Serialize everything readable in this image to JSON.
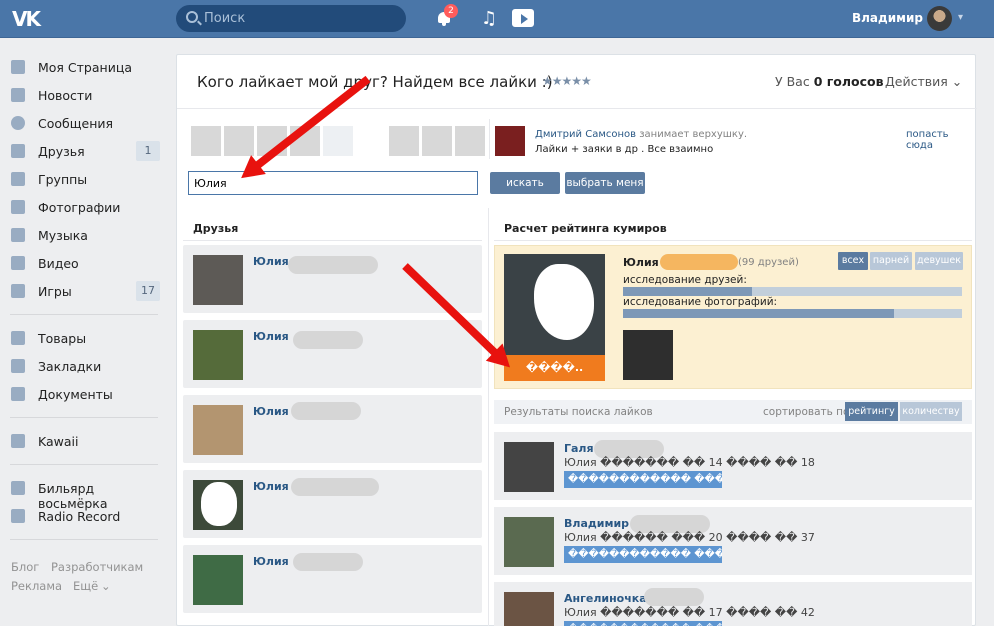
{
  "header": {
    "logo": "VK",
    "search_placeholder": "Поиск",
    "notifications_count": "2",
    "user_name": "Владимир"
  },
  "sidebar": {
    "items": [
      {
        "label": "Моя Страница",
        "icon": "house-icon"
      },
      {
        "label": "Новости",
        "icon": "news-icon"
      },
      {
        "label": "Сообщения",
        "icon": "messages-icon"
      },
      {
        "label": "Друзья",
        "icon": "friends-icon",
        "count": "1"
      },
      {
        "label": "Группы",
        "icon": "groups-icon"
      },
      {
        "label": "Фотографии",
        "icon": "camera-icon"
      },
      {
        "label": "Музыка",
        "icon": "music-icon"
      },
      {
        "label": "Видео",
        "icon": "video-icon"
      },
      {
        "label": "Игры",
        "icon": "gamepad-icon",
        "count": "17"
      },
      {
        "label": "Товары",
        "icon": "bag-icon"
      },
      {
        "label": "Закладки",
        "icon": "star-icon"
      },
      {
        "label": "Документы",
        "icon": "document-icon"
      },
      {
        "label": "Kawaii",
        "icon": "community-icon"
      },
      {
        "label": "Бильярд восьмёрка",
        "icon": "app-icon"
      },
      {
        "label": "Radio Record",
        "icon": "apps-grid-icon"
      }
    ],
    "footer": {
      "blog": "Блог",
      "developers": "Разработчикам",
      "ads": "Реклама",
      "more": "Ещё"
    }
  },
  "app": {
    "title": "Кого лайкает мой друг? Найдем все лайки :)",
    "stars": "★★★★★",
    "votes_prefix": "У Вас",
    "votes_count": "0 голосов",
    "actions": "Действия"
  },
  "promo": {
    "name": "Дмитрий Самсонов",
    "name_suffix": "занимает верхушку.",
    "text": "Лайки + заяки в др . Все взаимно",
    "link": "попасть сюда"
  },
  "search": {
    "value": "Юлия",
    "search_button": "искать",
    "select_me_button": "выбрать меня"
  },
  "friends": {
    "title": "Друзья",
    "items": [
      {
        "name": "Юлия"
      },
      {
        "name": "Юлия"
      },
      {
        "name": "Юлия"
      },
      {
        "name": "Юлия"
      },
      {
        "name": "Юлия"
      }
    ]
  },
  "idol": {
    "title": "Расчет рейтинга кумиров",
    "name": "Юлия",
    "friends_count": "(99 друзей)",
    "photo_label": "����..",
    "tabs": [
      "всех",
      "парней",
      "девушек"
    ],
    "research_friends_label": "исследование друзей:",
    "research_friends_progress": 0.38,
    "research_photos_label": "исследование фотографий:",
    "research_photos_progress": 0.8
  },
  "results": {
    "title": "Результаты поиска лайков",
    "sort_label": "сортировать по",
    "sort_options": [
      "рейтингу",
      "количеству"
    ],
    "items": [
      {
        "name": "Галя",
        "details": "Юлия ������� �� 14 ���� �� 18",
        "bar": "������������ ���"
      },
      {
        "name": "Владимир",
        "details": "Юлия ������ ��� 20 ���� �� 37",
        "bar": "������������ ���"
      },
      {
        "name": "Ангелиночка",
        "details": "Юлия ������� �� 17 ���� �� 42",
        "bar": "������������ ���"
      }
    ]
  },
  "colors": {
    "header": "#4a76a8",
    "link": "#2a5885",
    "orange": "#f07b1e",
    "arrow": "#e8120e"
  }
}
